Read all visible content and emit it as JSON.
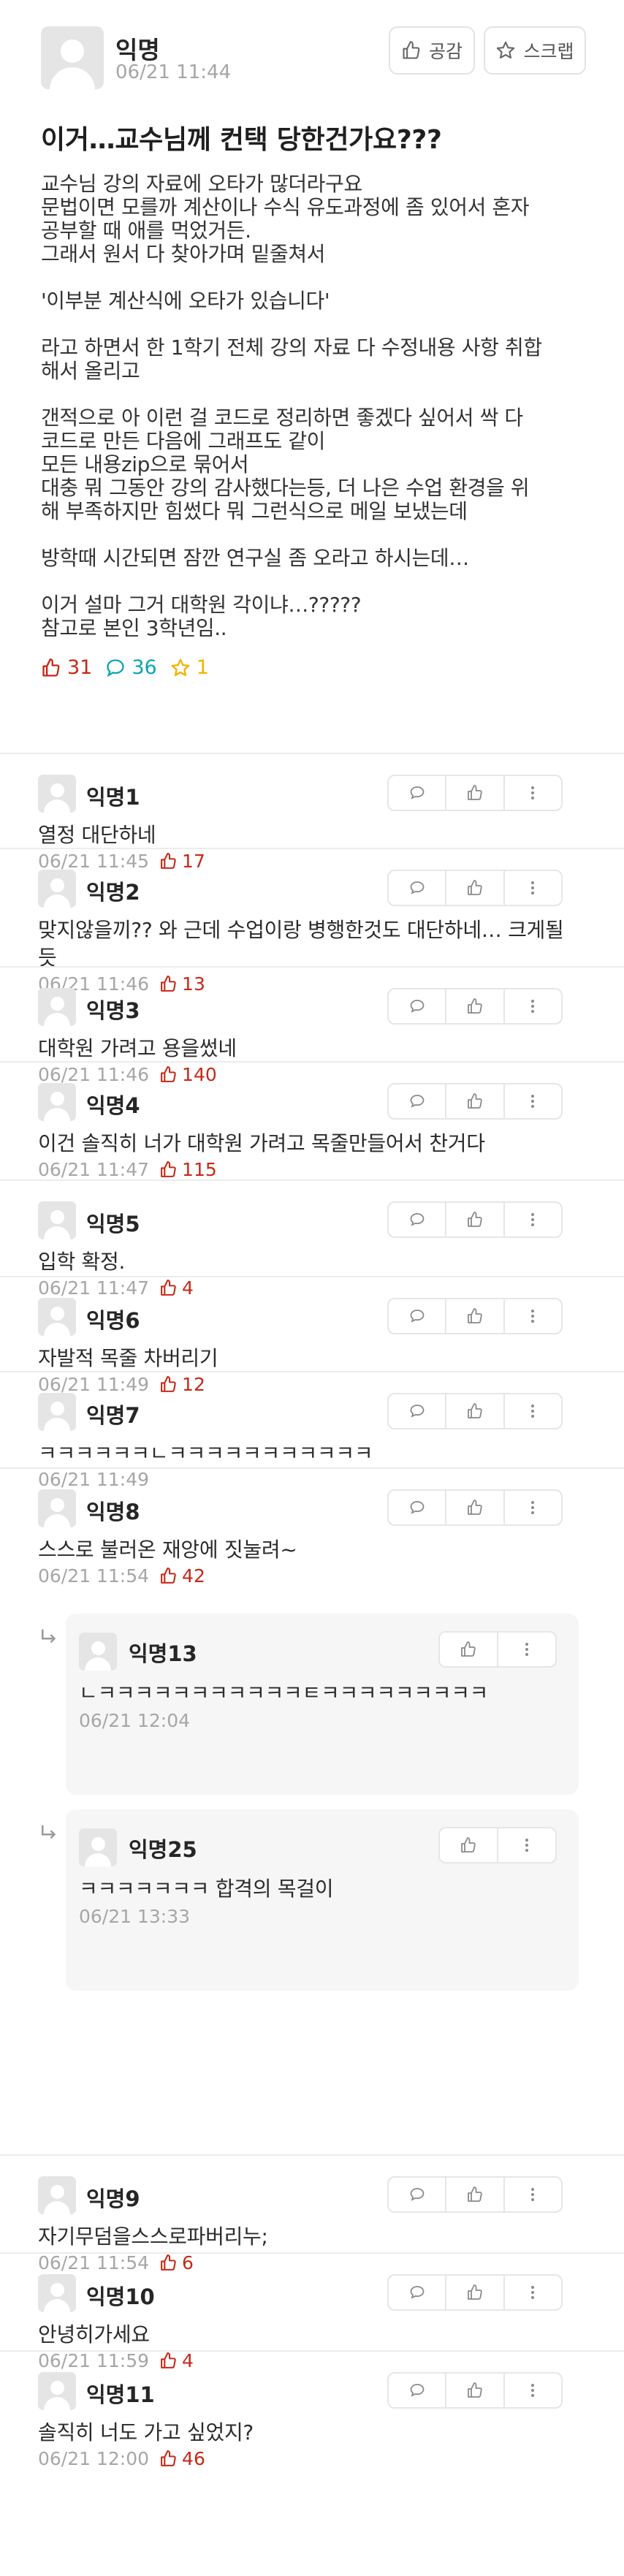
{
  "article": {
    "author": "익명",
    "time": "06/21 11:44",
    "like_button": "공감",
    "scrap_button": "스크랩",
    "title": "이거…교수님께 컨택 당한건가요???",
    "body": "교수님 강의 자료에 오타가 많더라구요\n문법이면 모를까 계산이나 수식 유도과정에 좀 있어서 혼자\n공부할 때 애를 먹었거든.\n그래서 원서 다 찾아가며 밑줄쳐서\n\n'이부분 계산식에 오타가 있습니다'\n\n라고 하면서 한 1학기 전체 강의 자료 다 수정내용 사항 취합\n해서 올리고\n\n갠적으로 아 이런 걸 코드로 정리하면 좋겠다 싶어서 싹 다\n코드로 만든 다음에 그래프도 같이\n모든 내용zip으로 묶어서\n대충 뭐 그동안 강의 감사했다는등, 더 나은 수업 환경을 위\n해 부족하지만 힘썼다 뭐 그런식으로 메일 보냈는데\n\n방학때 시간되면 잠깐 연구실 좀 오라고 하시는데…\n\n이거 설마 그거 대학원 각이냐…?????\n참고로 본인 3학년임..",
    "likes": "31",
    "comments": "36",
    "scraps": "1"
  },
  "icons": {
    "like": "thumbs-up-icon",
    "comment": "speech-bubble-icon",
    "scrap": "star-icon",
    "more": "vertical-dots-icon",
    "reply": "reply-arrow-icon"
  },
  "colors": {
    "like": "#c62917",
    "comment": "#0ca5af",
    "scrap": "#f2b300",
    "meta": "#a6a6a6"
  },
  "comments": [
    {
      "nick": "익명1",
      "text": "열정 대단하네",
      "time": "06/21 11:45",
      "likes": "17"
    },
    {
      "nick": "익명2",
      "text": "맞지않을끼?? 와 근데 수업이랑 병행한것도 대단하네… 크게될듯",
      "time": "06/21 11:46",
      "likes": "13"
    },
    {
      "nick": "익명3",
      "text": "대학원 가려고 용을썼네",
      "time": "06/21 11:46",
      "likes": "140"
    },
    {
      "nick": "익명4",
      "text": "이건 솔직히 너가 대학원 가려고 목줄만들어서 찬거다",
      "time": "06/21 11:47",
      "likes": "115"
    },
    {
      "nick": "익명5",
      "text": "입학 확정.",
      "time": "06/21 11:47",
      "likes": "4"
    },
    {
      "nick": "익명6",
      "text": "자발적 목줄 차버리기",
      "time": "06/21 11:49",
      "likes": "12"
    },
    {
      "nick": "익명7",
      "text": "ㅋㅋㅋㅋㅋㅋㄴㅋㅋㅋㅋㅋㅋㅋㅋㅋㅋㅋ",
      "time": "06/21 11:49",
      "likes": ""
    },
    {
      "nick": "익명8",
      "text": "스스로 불러온 재앙에 짓눌려~",
      "time": "06/21 11:54",
      "likes": "42"
    },
    {
      "nick": "익명9",
      "text": "자기무덤을스스로파버리누;",
      "time": "06/21 11:54",
      "likes": "6"
    },
    {
      "nick": "익명10",
      "text": "안녕히가세요",
      "time": "06/21 11:59",
      "likes": "4"
    },
    {
      "nick": "익명11",
      "text": "솔직히 너도 가고 싶었지?",
      "time": "06/21 12:00",
      "likes": "46"
    }
  ],
  "replies": [
    {
      "nick": "익명13",
      "text": "ㄴㅋㅋㅋㅋㅋㅋㅋㅋㅋㅋㅋㅌㅋㅋㅋㅋㅋㅋㅋㅋㅋ",
      "time": "06/21 12:04"
    },
    {
      "nick": "익명25",
      "text": "ㅋㅋㅋㅋㅋㅋㅋ 합격의 목걸이",
      "time": "06/21 13:33"
    }
  ]
}
